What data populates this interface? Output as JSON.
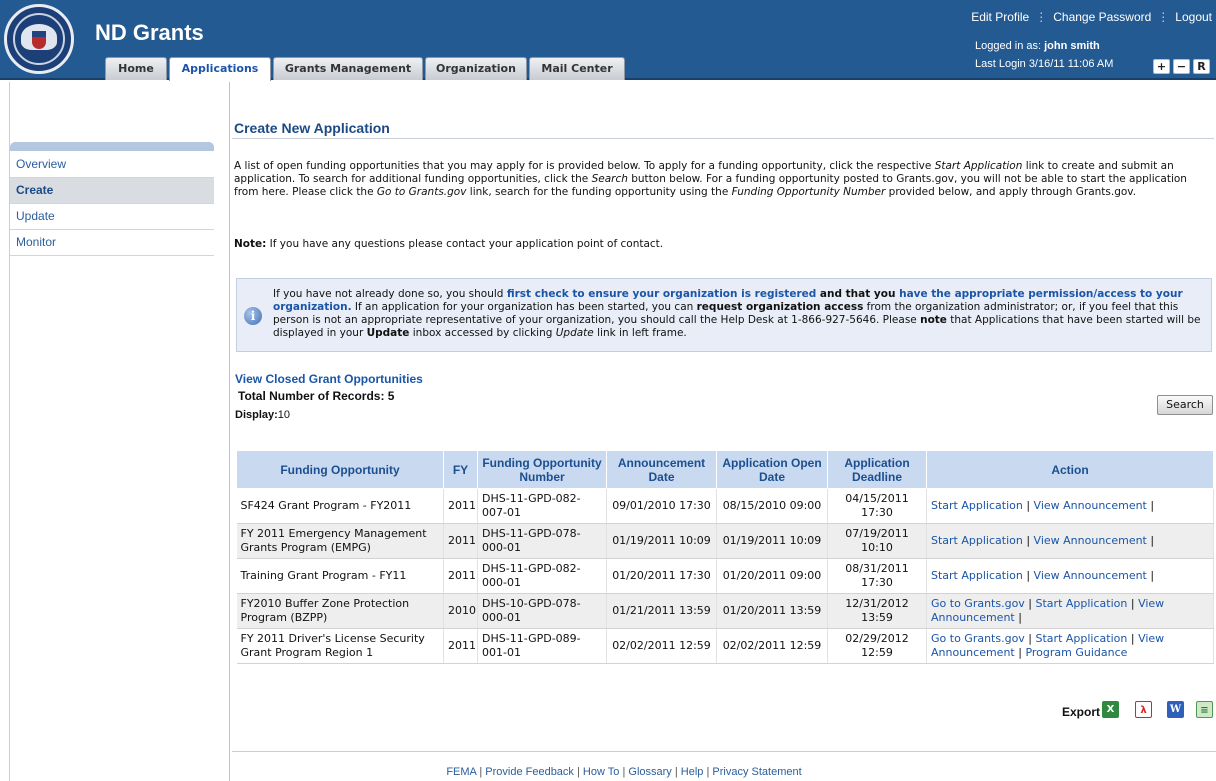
{
  "header": {
    "app_title": "ND Grants",
    "tabs": [
      "Home",
      "Applications",
      "Grants Management",
      "Organization",
      "Mail Center"
    ],
    "links": {
      "edit_profile": "Edit Profile",
      "change_password": "Change Password",
      "logout": "Logout"
    },
    "logged_in_label": "Logged in as:",
    "user_name": "john smith",
    "last_login": "Last Login 3/16/11 11:06 AM",
    "size_buttons": [
      "+",
      "−",
      "R"
    ]
  },
  "sidebar": {
    "items": [
      "Overview",
      "Create",
      "Update",
      "Monitor"
    ]
  },
  "main": {
    "title": "Create New Application",
    "intro": {
      "p1": "A list of open funding opportunities that you may apply for is provided below. To apply for a funding opportunity, click the respective ",
      "start_app": "Start Application",
      "p2": " link to create and submit an application. To search for additional funding opportunities, click the ",
      "search": "Search",
      "p3": " button below. For a funding opportunity posted to Grants.gov, you will not be able to start the application from here. Please click the ",
      "goto": "Go to Grants.gov",
      "p4": " link, search for the funding opportunity using the ",
      "fon": "Funding Opportunity Number",
      "p5": " provided below, and apply through Grants.gov."
    },
    "note_label": "Note:",
    "note_text": " If you have any questions please contact your application point of contact.",
    "info": {
      "t1": "If you have not already done so, you should ",
      "link1": "first check to ensure your organization is registered",
      "t2": " and that you ",
      "link2": "have the appropriate permission/access to your organization.",
      "t3": " If an application for your organization has been started, you can ",
      "b1": "request organization access",
      "t4": " from the organization administrator; or, if you feel that this person is not an appropriate representative of your organization, you should call the Help Desk at 1-866-927-5646. Please ",
      "b2": "note",
      "t5": " that Applications that have been started will be displayed in your ",
      "b3": "Update",
      "t6": " inbox accessed by clicking ",
      "i1": "Update",
      "t7": " link in left frame."
    },
    "closed_link": "View Closed Grant Opportunities",
    "records_label": "Total Number of Records: 5",
    "display_label": "Display:",
    "display_value": "10",
    "search_button": "Search",
    "table": {
      "headers": [
        "Funding Opportunity",
        "FY",
        "Funding Opportunity Number",
        "Announcement Date",
        "Application Open Date",
        "Application Deadline",
        "Action"
      ],
      "rows": [
        {
          "name": "SF424 Grant Program - FY2011",
          "fy": "2011",
          "number": "DHS-11-GPD-082-007-01",
          "ann": "09/01/2010 17:30",
          "open": "08/15/2010 09:00",
          "deadline": "04/15/2011 17:30",
          "actions": [
            "Start Application",
            "View Announcement"
          ]
        },
        {
          "name": "FY 2011 Emergency Management Grants Program (EMPG)",
          "fy": "2011",
          "number": "DHS-11-GPD-078-000-01",
          "ann": "01/19/2011 10:09",
          "open": "01/19/2011 10:09",
          "deadline": "07/19/2011 10:10",
          "actions": [
            "Start Application",
            "View Announcement"
          ]
        },
        {
          "name": "Training Grant Program - FY11",
          "fy": "2011",
          "number": "DHS-11-GPD-082-000-01",
          "ann": "01/20/2011 17:30",
          "open": "01/20/2011 09:00",
          "deadline": "08/31/2011 17:30",
          "actions": [
            "Start Application",
            "View Announcement"
          ]
        },
        {
          "name": "FY2010 Buffer Zone Protection Program (BZPP)",
          "fy": "2010",
          "number": "DHS-10-GPD-078-000-01",
          "ann": "01/21/2011 13:59",
          "open": "01/20/2011 13:59",
          "deadline": "12/31/2012 13:59",
          "actions": [
            "Go to Grants.gov",
            "Start Application",
            "View Announcement"
          ]
        },
        {
          "name": "FY 2011 Driver's License Security Grant Program Region 1",
          "fy": "2011",
          "number": "DHS-11-GPD-089-001-01",
          "ann": "02/02/2011 12:59",
          "open": "02/02/2011 12:59",
          "deadline": "02/29/2012 12:59",
          "actions": [
            "Go to Grants.gov",
            "Start Application",
            "View Announcement",
            "Program Guidance"
          ]
        }
      ]
    },
    "export_label": "Export :",
    "export_icons": [
      "excel-icon",
      "pdf-icon",
      "word-icon",
      "csv-icon"
    ]
  },
  "footer": {
    "links": [
      "FEMA",
      "Provide Feedback",
      "How To",
      "Glossary",
      "Help",
      "Privacy Statement"
    ]
  }
}
